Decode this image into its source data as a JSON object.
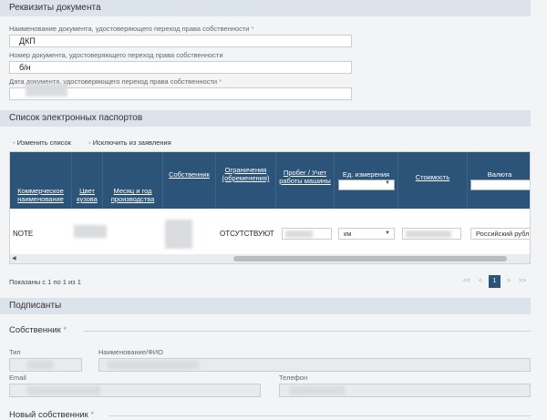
{
  "document_details": {
    "title": "Реквизиты документа",
    "fields": [
      {
        "label": "Наименование документа, удостоверяющего переход права собственности",
        "required": "*",
        "value": "ДКП"
      },
      {
        "label": "Номер документа, удостоверяющего переход права собственности",
        "required": "",
        "value": "б/н"
      },
      {
        "label": "Дата документа, удостоверяющего переход права собственности",
        "required": "*",
        "value": ""
      }
    ]
  },
  "passports": {
    "title": "Список электронных паспортов",
    "actions": [
      "Изменить список",
      "Исключить из заявления"
    ],
    "columns": [
      "Коммерческое наименование",
      "Цвет кузова",
      "Месяц и год производства",
      "Собственник",
      "Ограничения (обременения)",
      "Пробег / Учет работы машины",
      "Ед. измерения",
      "Стоимость",
      "Валюта"
    ],
    "row": {
      "name": "NOTE",
      "restrictions": "ОТСУТСТВУЮТ",
      "unit": "км",
      "currency": "Российский рубль"
    },
    "pagination": {
      "summary": "Показаны с 1 по 1 из 1",
      "first": "<<",
      "prev": "<",
      "current": "1",
      "next": ">",
      "last": ">>"
    }
  },
  "signers": {
    "title": "Подписанты",
    "owner": {
      "heading": "Собственник",
      "required": "*",
      "type_label": "Тип",
      "name_label": "Наименование/ФИО",
      "email_label": "Email",
      "phone_label": "Телефон"
    },
    "new_owner": {
      "heading": "Новый собственник",
      "required": "*"
    }
  },
  "colors": {
    "header_band": "#dde3ea",
    "table_header": "#2c5479",
    "page_active": "#2c5479"
  }
}
